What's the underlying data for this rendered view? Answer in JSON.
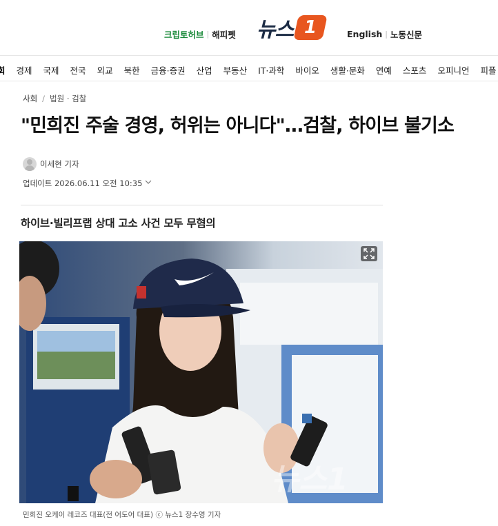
{
  "header": {
    "left_links": [
      "크립토허브",
      "해피펫"
    ],
    "logo_text": "뉴스",
    "logo_badge": "1",
    "right_links": [
      "English",
      "노동신문"
    ]
  },
  "nav": {
    "items": [
      "회",
      "경제",
      "국제",
      "전국",
      "외교",
      "북한",
      "금융·증권",
      "산업",
      "부동산",
      "IT·과학",
      "바이오",
      "생활·문화",
      "연예",
      "스포츠",
      "오피니언",
      "피플"
    ],
    "active_index": 0
  },
  "breadcrumb": {
    "section": "사회",
    "subsection": "법원 · 검찰"
  },
  "article": {
    "headline": "\"민희진 주술 경영, 허위는 아니다\"…검찰, 하이브 불기소",
    "author": "이세현 기자",
    "updated": "업데이트 2026.06.11 오전 10:35",
    "subtitle": "하이브·빌리프랩 상대 고소 사건 모두 무혐의",
    "caption": "민희진 오케이 레코즈 대표(전 어도어 대표) ⓒ 뉴스1 장수영 기자",
    "watermark": "뉴스1"
  },
  "colors": {
    "brand_orange": "#e8561f",
    "brand_navy": "#1b2b44",
    "link_green": "#1a8a3a"
  },
  "icons": [
    "expand-icon",
    "chevron-down-icon",
    "avatar-icon"
  ]
}
